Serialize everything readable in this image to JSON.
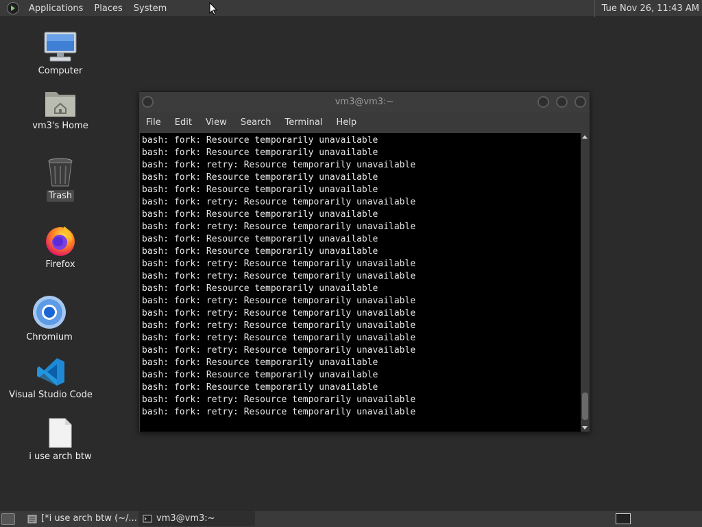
{
  "top_panel": {
    "menus": [
      "Applications",
      "Places",
      "System"
    ],
    "clock": "Tue Nov 26, 11:43 AM"
  },
  "desktop": {
    "icons": [
      {
        "label": "Computer",
        "icon": "computer-icon"
      },
      {
        "label": "vm3's Home",
        "icon": "home-folder-icon"
      },
      {
        "label": "Trash",
        "icon": "trash-icon"
      },
      {
        "label": "Firefox",
        "icon": "firefox-icon"
      },
      {
        "label": "Chromium",
        "icon": "chromium-icon"
      },
      {
        "label": "Visual Studio Code",
        "icon": "vscode-icon"
      },
      {
        "label": "i use arch btw",
        "icon": "text-file-icon"
      }
    ]
  },
  "terminal": {
    "title": "vm3@vm3:~",
    "menu": [
      "File",
      "Edit",
      "View",
      "Search",
      "Terminal",
      "Help"
    ],
    "lines": [
      "bash: fork: Resource temporarily unavailable",
      "bash: fork: Resource temporarily unavailable",
      "bash: fork: retry: Resource temporarily unavailable",
      "bash: fork: Resource temporarily unavailable",
      "bash: fork: Resource temporarily unavailable",
      "bash: fork: retry: Resource temporarily unavailable",
      "bash: fork: Resource temporarily unavailable",
      "bash: fork: retry: Resource temporarily unavailable",
      "bash: fork: Resource temporarily unavailable",
      "bash: fork: Resource temporarily unavailable",
      "bash: fork: retry: Resource temporarily unavailable",
      "bash: fork: retry: Resource temporarily unavailable",
      "bash: fork: Resource temporarily unavailable",
      "bash: fork: retry: Resource temporarily unavailable",
      "bash: fork: retry: Resource temporarily unavailable",
      "bash: fork: retry: Resource temporarily unavailable",
      "bash: fork: retry: Resource temporarily unavailable",
      "bash: fork: retry: Resource temporarily unavailable",
      "bash: fork: Resource temporarily unavailable",
      "bash: fork: Resource temporarily unavailable",
      "bash: fork: Resource temporarily unavailable",
      "bash: fork: retry: Resource temporarily unavailable",
      "bash: fork: retry: Resource temporarily unavailable"
    ]
  },
  "taskbar": {
    "tasks": [
      {
        "label": "[*i use arch btw (~/...",
        "icon": "text-editor-icon",
        "active": false
      },
      {
        "label": "vm3@vm3:~",
        "icon": "terminal-icon",
        "active": true
      }
    ]
  }
}
